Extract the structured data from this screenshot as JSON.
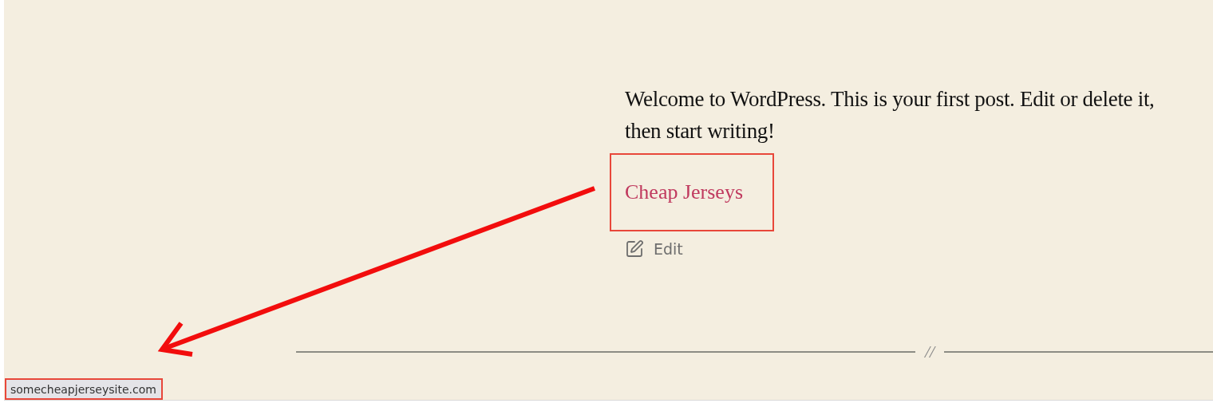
{
  "post": {
    "paragraph": "Welcome to WordPress. This is your first post. Edit or delete it, then start writing!",
    "link": "Cheap Jerseys",
    "edit_label": "Edit"
  },
  "separator": {
    "mark": "//"
  },
  "status_url": "somecheapjerseysite.com"
}
